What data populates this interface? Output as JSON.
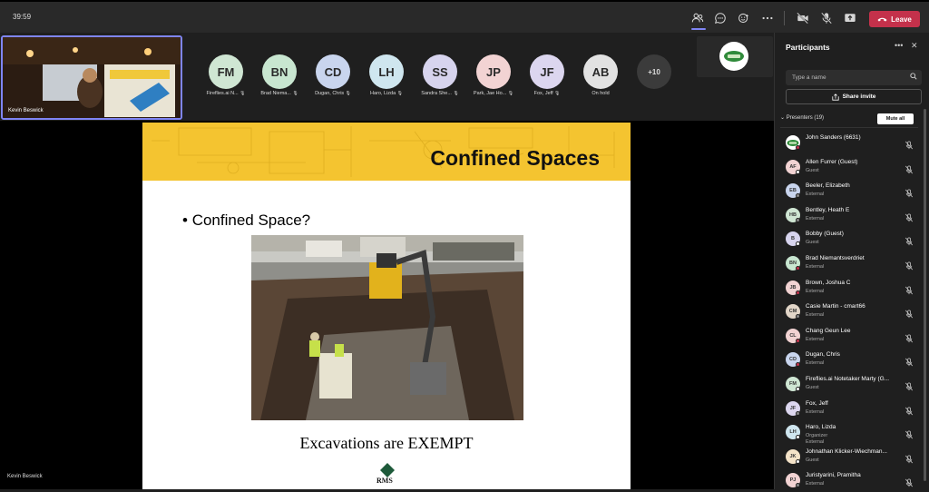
{
  "topbar": {
    "timer": "39:59",
    "leave_label": "Leave"
  },
  "self_view": {
    "name": "Kevin Beswick"
  },
  "participants_strip": [
    {
      "initials": "FM",
      "label": "Fireflies.ai N...",
      "color": "#cfe6d3"
    },
    {
      "initials": "BN",
      "label": "Brad Niema...",
      "color": "#c8e6d0"
    },
    {
      "initials": "CD",
      "label": "Dugan, Chris",
      "color": "#c9d5ee"
    },
    {
      "initials": "LH",
      "label": "Haro, Lizda",
      "color": "#cfe6ef"
    },
    {
      "initials": "SS",
      "label": "Sandra She...",
      "color": "#d7d4ee"
    },
    {
      "initials": "JP",
      "label": "Park, Jae Ho...",
      "color": "#f2d3d3"
    },
    {
      "initials": "JF",
      "label": "Fox, Jeff",
      "color": "#dcd6ef"
    },
    {
      "initials": "AB",
      "label": "On hold",
      "color": "#e2e2e2"
    }
  ],
  "overflow_count": "+10",
  "slide": {
    "title": "Confined Spaces",
    "bullet": "Confined Space?",
    "caption": "Excavations are EXEMPT",
    "logo_text": "RMS"
  },
  "presenter_label": "Kevin Beswick",
  "panel": {
    "title": "Participants",
    "search_placeholder": "Type a name",
    "share_label": "Share invite",
    "presenters_header": "Presenters (19)",
    "mute_all_label": "Mute all",
    "people": [
      {
        "initials": "",
        "name": "John Sanders (6631)",
        "sub": "",
        "color": "#ffffff",
        "status": "#c4314b",
        "logo": true
      },
      {
        "initials": "AF",
        "name": "Allen Furrer (Guest)",
        "sub": "Guest",
        "color": "#f2d3d3",
        "status": "#ffffff"
      },
      {
        "initials": "EB",
        "name": "Beeler, Elizabeth",
        "sub": "External",
        "color": "#c9d5ee",
        "status": "#888888"
      },
      {
        "initials": "HB",
        "name": "Bentley, Heath E",
        "sub": "External",
        "color": "#cfe6d3",
        "status": "#888888"
      },
      {
        "initials": "B",
        "name": "Bobby (Guest)",
        "sub": "Guest",
        "color": "#d7d4ee",
        "status": "#ffffff"
      },
      {
        "initials": "BN",
        "name": "Brad Niemantsverdriet",
        "sub": "External",
        "color": "#c8e6d0",
        "status": "#c4314b"
      },
      {
        "initials": "JB",
        "name": "Brown, Joshua C",
        "sub": "External",
        "color": "#f2d3d3",
        "status": "#c4314b"
      },
      {
        "initials": "CM",
        "name": "Casie Martin - cmart66",
        "sub": "External",
        "color": "#e2d6c8",
        "status": "#888888"
      },
      {
        "initials": "CL",
        "name": "Chang Geun Lee",
        "sub": "External",
        "color": "#f2d3d3",
        "status": "#c4314b"
      },
      {
        "initials": "CD",
        "name": "Dugan, Chris",
        "sub": "External",
        "color": "#c9d5ee",
        "status": "#c4314b"
      },
      {
        "initials": "FM",
        "name": "Fireflies.ai Notetaker Marty (G...",
        "sub": "Guest",
        "color": "#cfe6d3",
        "status": "#ffffff"
      },
      {
        "initials": "JF",
        "name": "Fox, Jeff",
        "sub": "External",
        "color": "#dcd6ef",
        "status": "#888888"
      },
      {
        "initials": "LH",
        "name": "Haro, Lizda",
        "sub": "Organizer",
        "sub2": "External",
        "color": "#cfe6ef",
        "status": "#ffffff"
      },
      {
        "initials": "JK",
        "name": "Johnathan Klicker-Wiechman...",
        "sub": "Guest",
        "color": "#f4e3c8",
        "status": "#ffffff"
      },
      {
        "initials": "PJ",
        "name": "Juristyarini, Pramitha",
        "sub": "External",
        "color": "#f2d3d3",
        "status": "#888888"
      }
    ]
  }
}
